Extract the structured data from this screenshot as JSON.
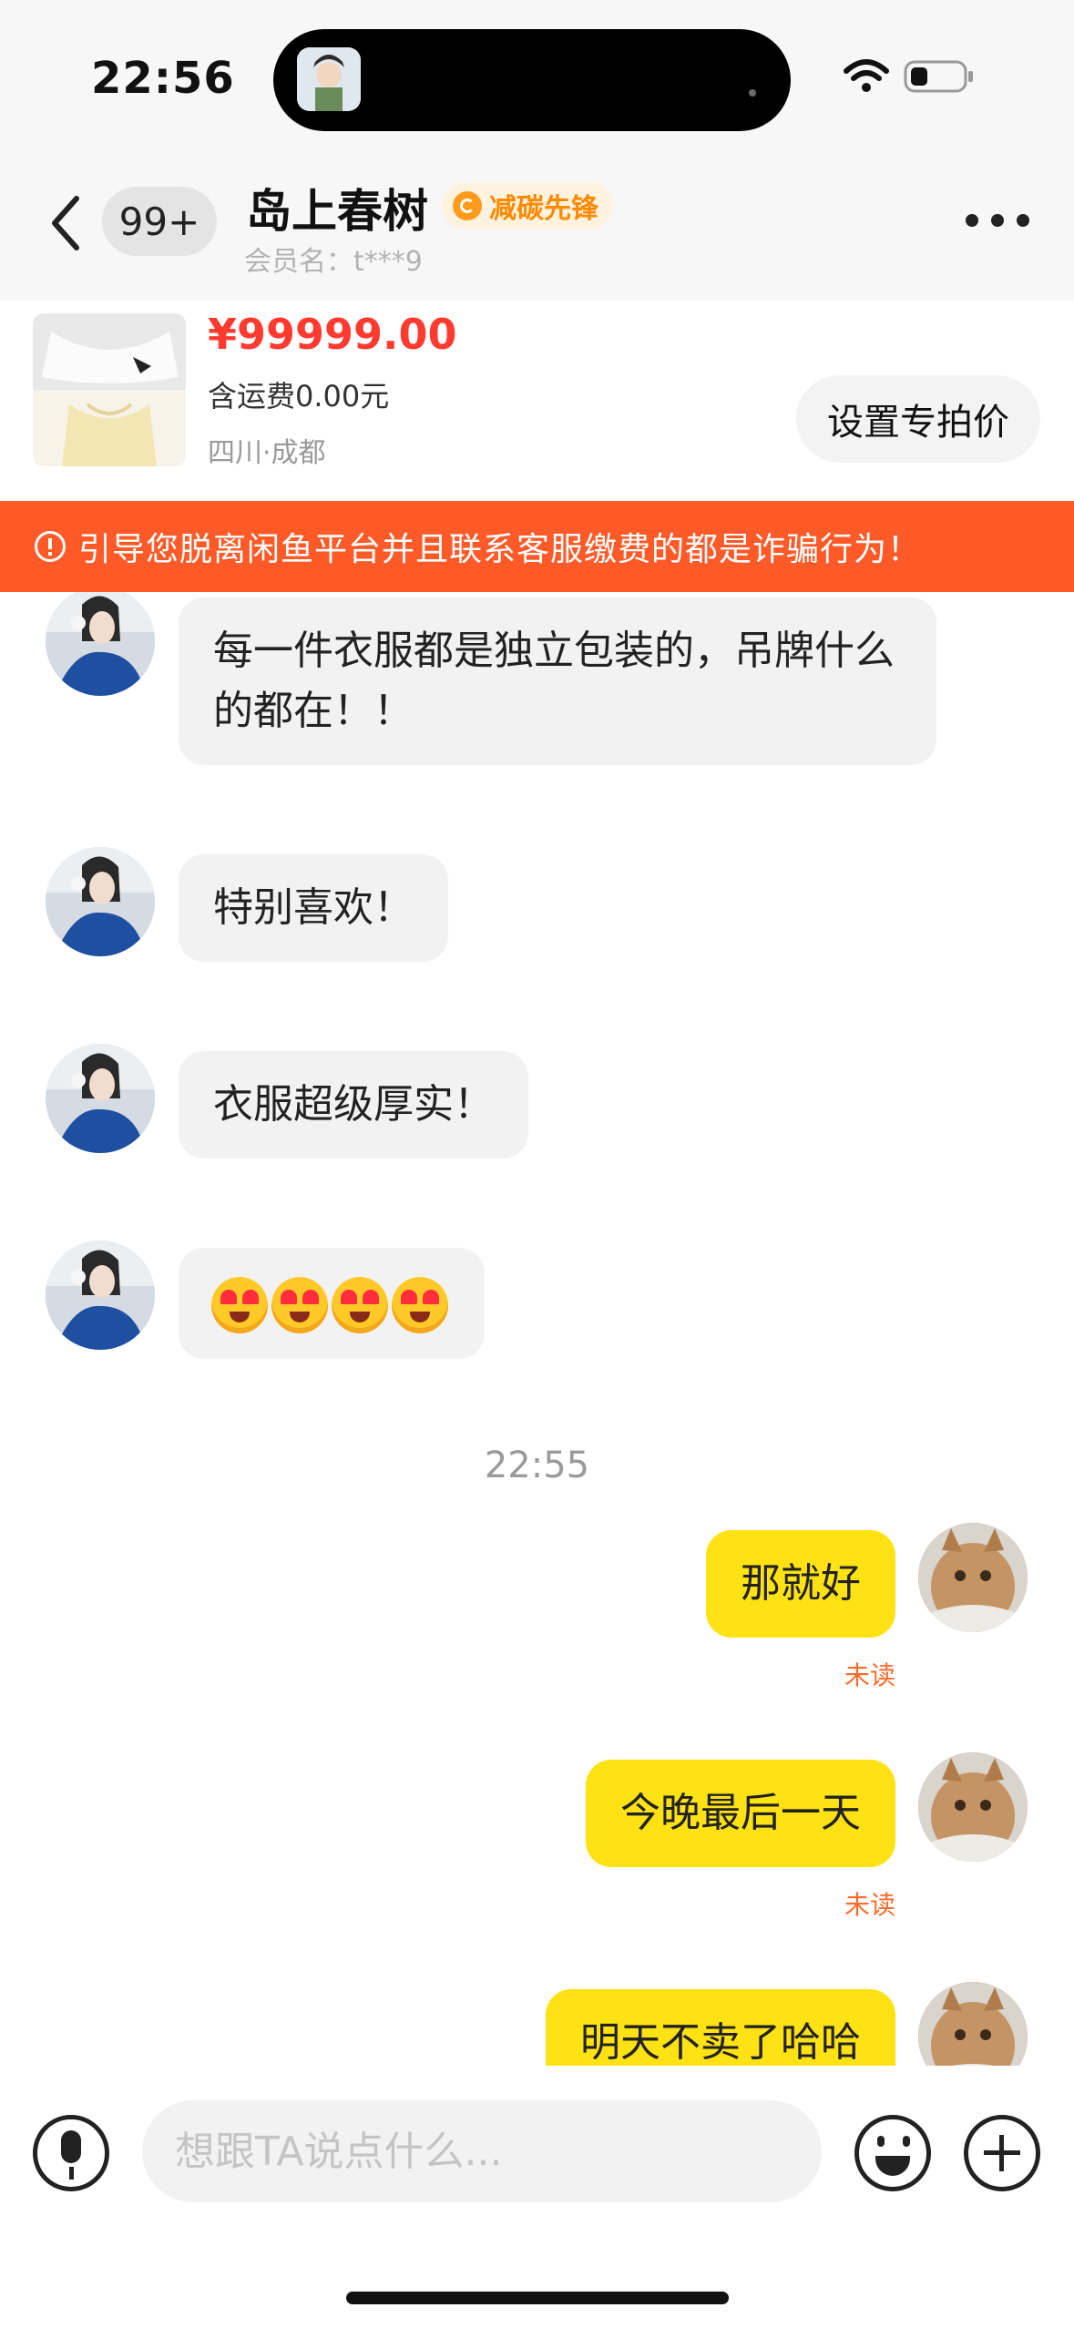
{
  "status_bar": {
    "time": "22:56"
  },
  "header": {
    "unread_count": "99+",
    "contact_name": "岛上春树",
    "badge_label": "减碳先锋",
    "member_name": "会员名：t***9"
  },
  "product": {
    "price": "¥99999.00",
    "shipping": "含运费0.00元",
    "location": "四川·成都",
    "set_price_label": "设置专拍价"
  },
  "warning": {
    "text": "引导您脱离闲鱼平台并且联系客服缴费的都是诈骗行为！"
  },
  "messages": {
    "in_1": "每一件衣服都是独立包装的，吊牌什么的都在！！",
    "in_2": "特别喜欢！",
    "in_3": "衣服超级厚实！",
    "time_separator": "22:55",
    "out_1": "那就好",
    "out_1_status": "未读",
    "out_2": "今晚最后一天",
    "out_2_status": "未读",
    "out_3": "明天不卖了哈哈"
  },
  "input": {
    "placeholder": "想跟TA说点什么..."
  },
  "colors": {
    "accent_yellow": "#ffe214",
    "warning_orange": "#ff5a28",
    "price_red": "#ff3b30",
    "unread_orange": "#ff6a2a"
  }
}
